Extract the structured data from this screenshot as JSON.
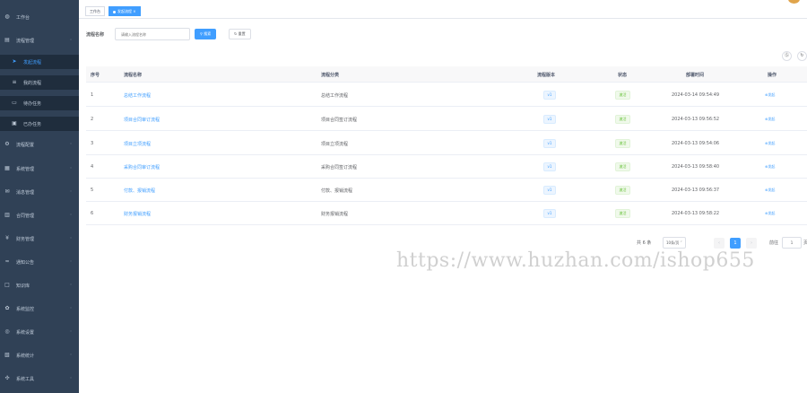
{
  "sidebar": {
    "items": [
      {
        "label": "工作台",
        "icon": "dashboard-icon",
        "chev": ""
      },
      {
        "label": "流程管理",
        "icon": "flow-icon",
        "chev": "˄"
      },
      {
        "label": "发起流程",
        "icon": "send-icon",
        "chev": ""
      },
      {
        "label": "我的流程",
        "icon": "list-icon",
        "chev": ""
      },
      {
        "label": "待办任务",
        "icon": "todo-icon",
        "chev": ""
      },
      {
        "label": "已办任务",
        "icon": "done-icon",
        "chev": ""
      },
      {
        "label": "流程配置",
        "icon": "config-icon",
        "chev": "˅"
      },
      {
        "label": "系统管理",
        "icon": "system-icon",
        "chev": "˅"
      },
      {
        "label": "消息管理",
        "icon": "message-icon",
        "chev": "˅"
      },
      {
        "label": "合同管理",
        "icon": "contract-icon",
        "chev": "˅"
      },
      {
        "label": "财务管理",
        "icon": "finance-icon",
        "chev": "˅"
      },
      {
        "label": "通知公告",
        "icon": "notice-icon",
        "chev": "˅"
      },
      {
        "label": "知识库",
        "icon": "knowledge-icon",
        "chev": "˅"
      },
      {
        "label": "系统监控",
        "icon": "monitor-icon",
        "chev": "˅"
      },
      {
        "label": "系统设置",
        "icon": "settings-icon",
        "chev": "˅"
      },
      {
        "label": "系统统计",
        "icon": "stats-icon",
        "chev": "˅"
      },
      {
        "label": "系统工具",
        "icon": "tools-icon",
        "chev": "˅"
      }
    ]
  },
  "tags": {
    "home": "工作台",
    "active": "发起流程 ×"
  },
  "search": {
    "label": "流程名称",
    "placeholder": "请输入流程名称",
    "search_button": "⚲ 搜索",
    "reset_button": "↻ 重置"
  },
  "toolbar": {
    "toggle_search": "Ⓢ",
    "refresh": "↻"
  },
  "table": {
    "headers": {
      "index": "序号",
      "name": "流程名称",
      "category": "流程分类",
      "version": "流程版本",
      "state": "状态",
      "deploy_time": "部署时间",
      "action": "操作"
    },
    "rows": [
      {
        "index": "1",
        "name": "总结工作流程",
        "category": "总结工作流程",
        "version": "v1",
        "state": "激活",
        "deploy_time": "2024-03-14 09:54:49",
        "action": "⊕发起"
      },
      {
        "index": "2",
        "name": "项目合同审订流程",
        "category": "项目合同签订流程",
        "version": "v1",
        "state": "激活",
        "deploy_time": "2024-03-13 09:56:52",
        "action": "⊕发起"
      },
      {
        "index": "3",
        "name": "项目立项流程",
        "category": "项目立项流程",
        "version": "v1",
        "state": "激活",
        "deploy_time": "2024-03-13 09:54:06",
        "action": "⊕发起"
      },
      {
        "index": "4",
        "name": "采购合同审订流程",
        "category": "采购合同签订流程",
        "version": "v1",
        "state": "激活",
        "deploy_time": "2024-03-13 09:58:40",
        "action": "⊕发起"
      },
      {
        "index": "5",
        "name": "付款、报销流程",
        "category": "付款、报销流程",
        "version": "v1",
        "state": "激活",
        "deploy_time": "2024-03-13 09:56:37",
        "action": "⊕发起"
      },
      {
        "index": "6",
        "name": "财务报销流程",
        "category": "财务报销流程",
        "version": "v1",
        "state": "激活",
        "deploy_time": "2024-03-13 09:58:22",
        "action": "⊕发起"
      }
    ]
  },
  "pagination": {
    "total": "共 6 条",
    "page_size": "10条/页 ˅",
    "prev": "‹",
    "current": "1",
    "next": "›",
    "goto_label": "前往",
    "goto_value": "1",
    "page_suffix": "页"
  },
  "watermark": "https://www.huzhan.com/ishop655",
  "colors": {
    "sidebar_bg": "#304156",
    "primary": "#409eff",
    "success": "#67c23a"
  }
}
